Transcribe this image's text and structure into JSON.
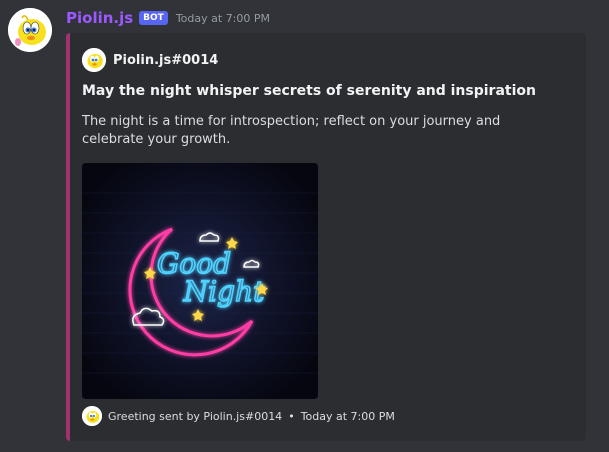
{
  "message": {
    "username": "Piolin.js",
    "bot_tag": "BOT",
    "timestamp": "Today at 7:00 PM"
  },
  "embed": {
    "author_name": "Piolin.js#0014",
    "title": "May the night whisper secrets of serenity and inspiration",
    "description": "The night is a time for introspection; reflect on your journey and celebrate your growth.",
    "image": {
      "subject": "neon good night sign with crescent moon, stars and clouds",
      "sign_line1": "Good",
      "sign_line2": "Night"
    },
    "footer": {
      "text": "Greeting sent by Piolin.js#0014",
      "separator": "•",
      "timestamp": "Today at 7:00 PM"
    },
    "accent_color": "#a0336f"
  },
  "colors": {
    "background": "#313338",
    "embed_bg": "#2b2d31",
    "username": "#9b59ff",
    "bot_tag": "#5865f2"
  }
}
